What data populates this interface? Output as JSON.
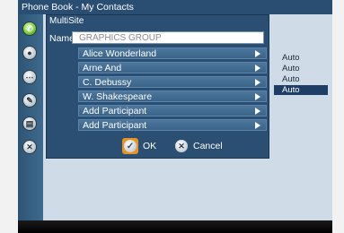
{
  "window": {
    "title": "Phone Book - My Contacts"
  },
  "sidebar": {
    "icons": [
      {
        "name": "phone-green-icon",
        "glyph": "✆"
      },
      {
        "name": "record-icon",
        "glyph": "●"
      },
      {
        "name": "keypad-icon",
        "glyph": "⋯"
      },
      {
        "name": "tools-icon",
        "glyph": "✎"
      },
      {
        "name": "info-icon",
        "glyph": "▤"
      },
      {
        "name": "close-icon",
        "glyph": "✕"
      }
    ]
  },
  "dialog": {
    "title": "MultiSite",
    "name_label": "Name",
    "name_value": "GRAPHICS GROUP",
    "participants": [
      {
        "label": "Alice Wonderland"
      },
      {
        "label": "Arne And"
      },
      {
        "label": "C. Debussy"
      },
      {
        "label": "W. Shakespeare"
      },
      {
        "label": "Add Participant"
      },
      {
        "label": "Add Participant"
      }
    ],
    "ok_label": "OK",
    "cancel_label": "Cancel"
  },
  "rate_options": {
    "items": [
      "Auto",
      "Auto",
      "Auto",
      "Auto"
    ],
    "selected_index": 3
  }
}
